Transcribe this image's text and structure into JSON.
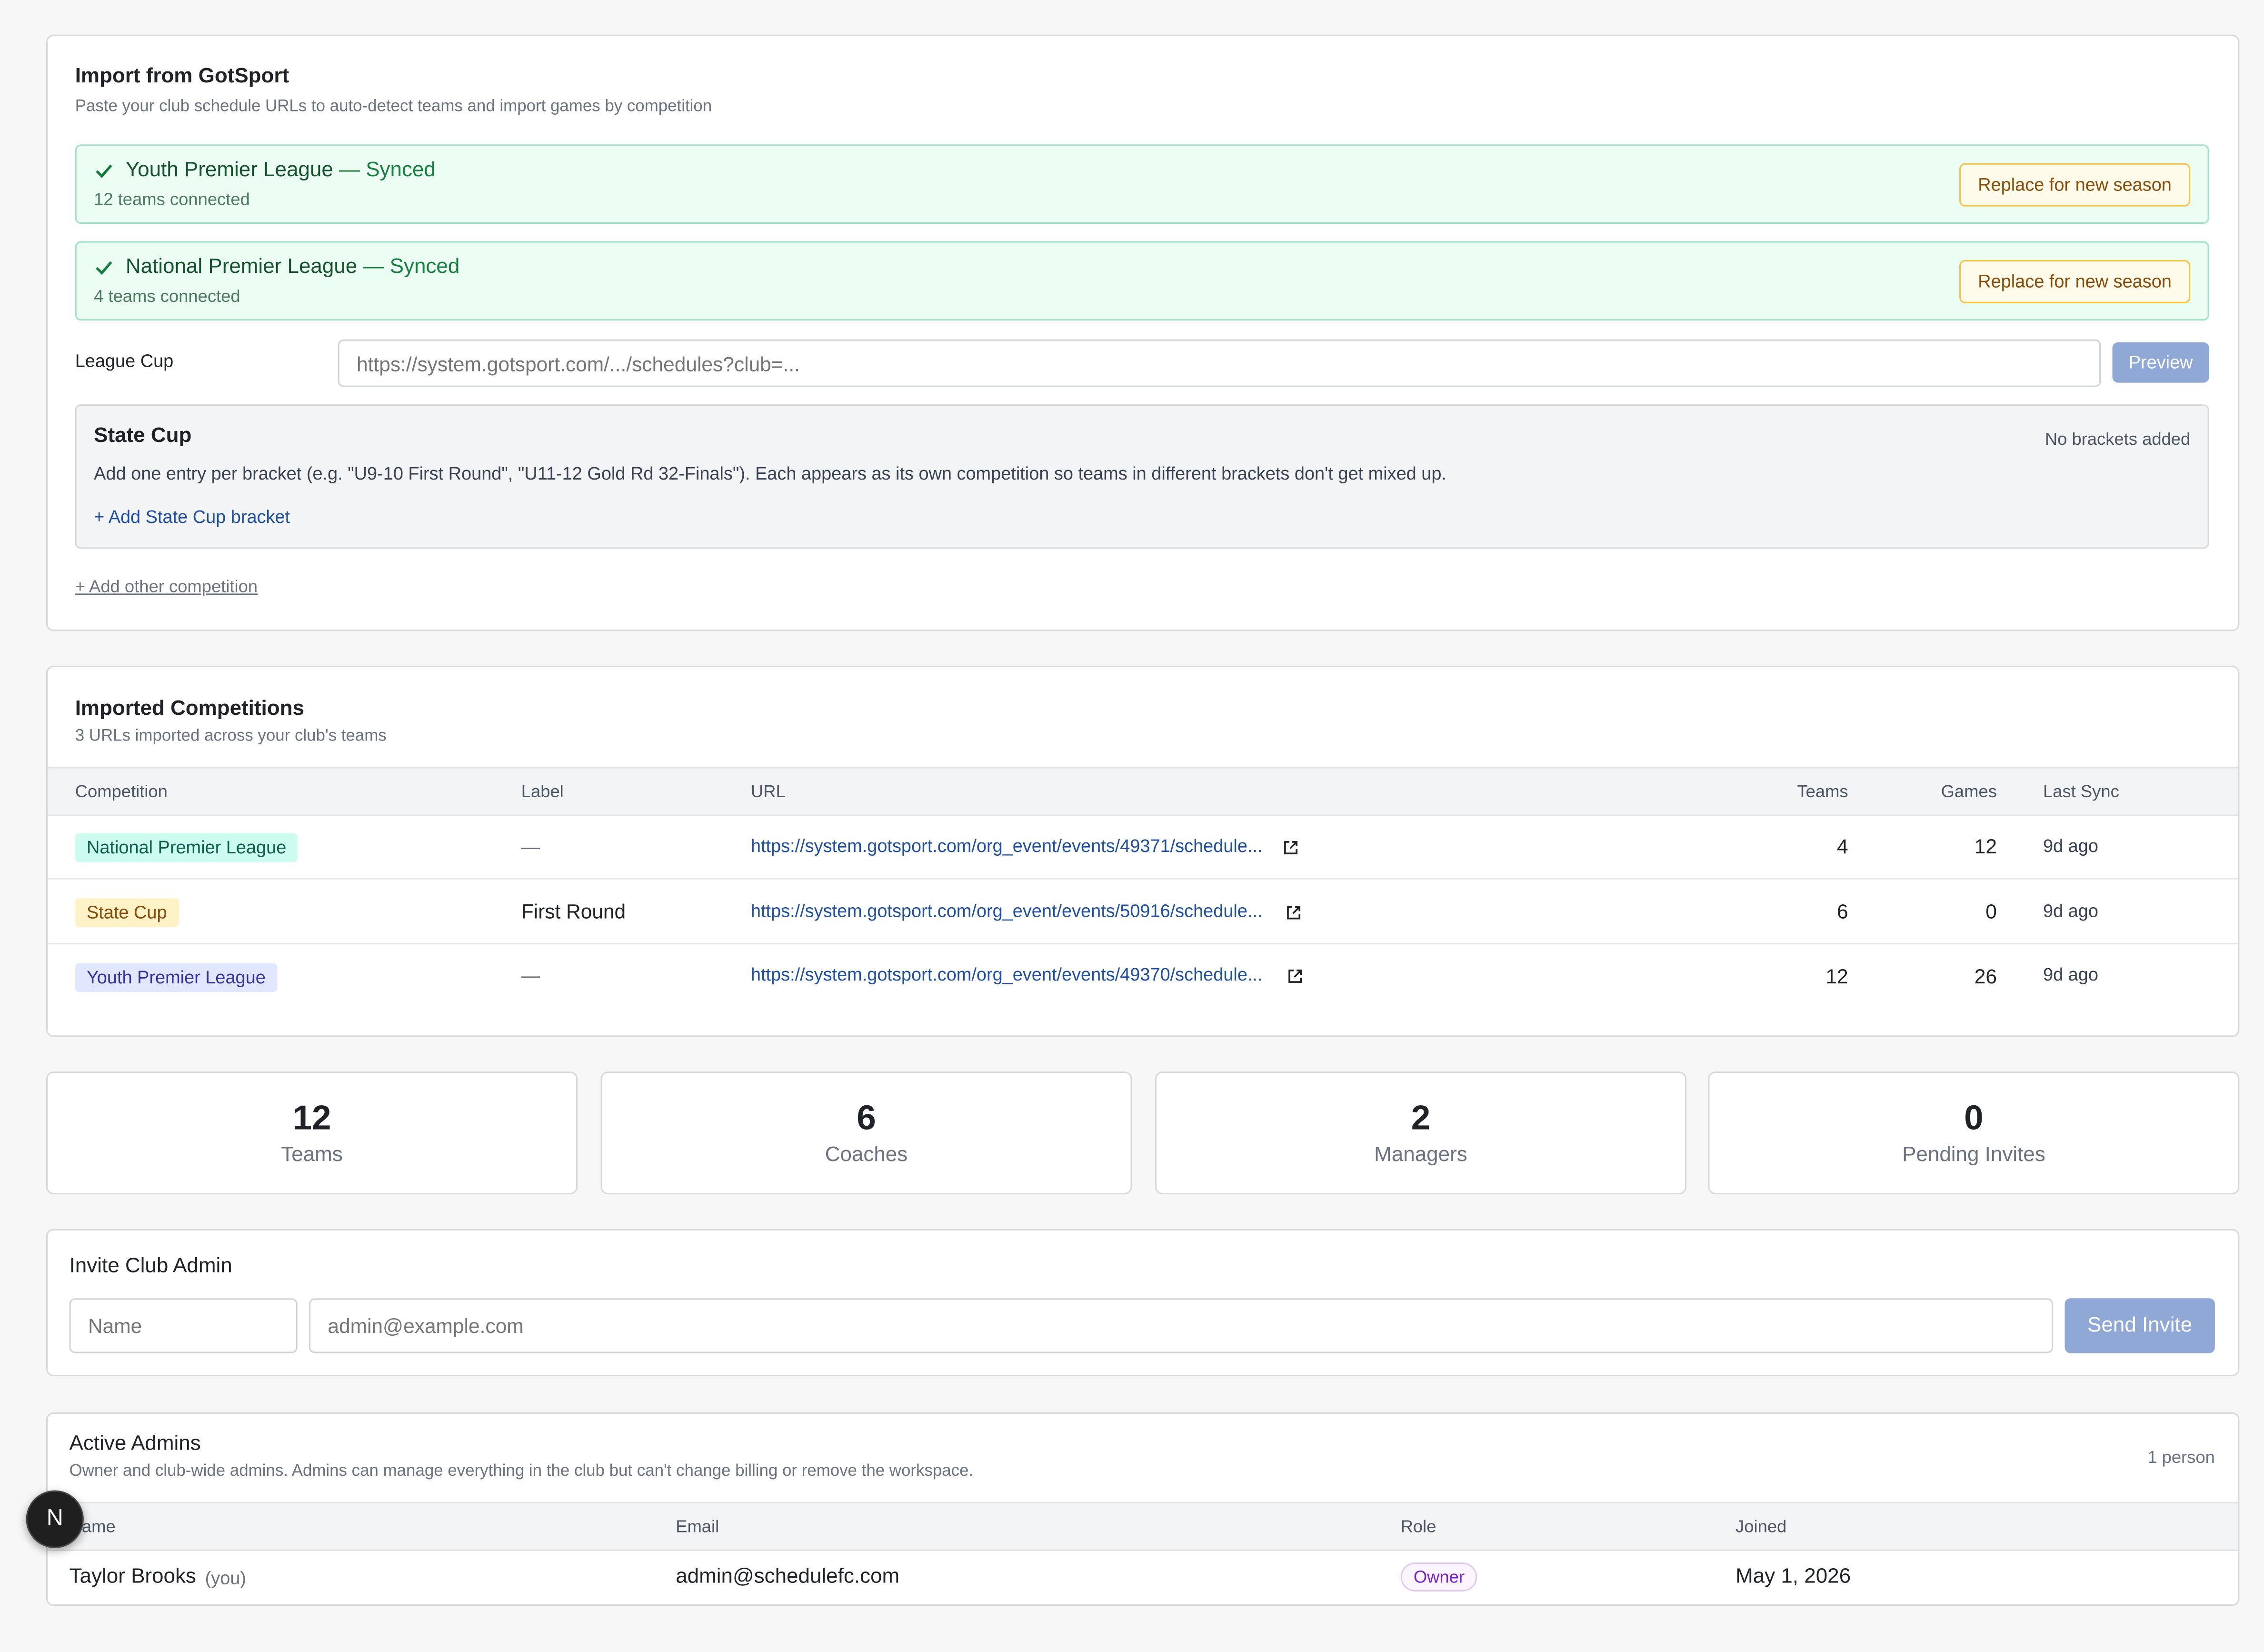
{
  "import": {
    "title": "Import from GotSport",
    "subtitle": "Paste your club schedule URLs to auto-detect teams and import games by competition",
    "synced": [
      {
        "name": "Youth Premier League",
        "status": " — Synced",
        "count": "12 teams connected",
        "button": "Replace for new season"
      },
      {
        "name": "National Premier League",
        "status": " — Synced",
        "count": "4 teams connected",
        "button": "Replace for new season"
      }
    ],
    "league_cup": {
      "label": "League Cup",
      "placeholder": "https://system.gotsport.com/.../schedules?club=...",
      "button": "Preview"
    },
    "state_cup": {
      "title": "State Cup",
      "status": "No brackets added",
      "description": "Add one entry per bracket (e.g. \"U9-10 First Round\", \"U11-12 Gold Rd 32-Finals\"). Each appears as its own competition so teams in different brackets don't get mixed up.",
      "add_link": "+ Add State Cup bracket"
    },
    "add_other": "+ Add other competition"
  },
  "imported": {
    "title": "Imported Competitions",
    "subtitle": "3 URLs imported across your club's teams",
    "columns": [
      "Competition",
      "Label",
      "URL",
      "Teams",
      "Games",
      "Last Sync"
    ],
    "rows": [
      {
        "competition": "National Premier League",
        "label": "—",
        "url": "https://system.gotsport.com/org_event/events/49371/schedule...",
        "teams": "4",
        "games": "12",
        "last_sync": "9d ago"
      },
      {
        "competition": "State Cup",
        "label": "First Round",
        "url": "https://system.gotsport.com/org_event/events/50916/schedule...",
        "teams": "6",
        "games": "0",
        "last_sync": "9d ago"
      },
      {
        "competition": "Youth Premier League",
        "label": "—",
        "url": "https://system.gotsport.com/org_event/events/49370/schedule...",
        "teams": "12",
        "games": "26",
        "last_sync": "9d ago"
      }
    ]
  },
  "stats": [
    {
      "value": "12",
      "label": "Teams"
    },
    {
      "value": "6",
      "label": "Coaches"
    },
    {
      "value": "2",
      "label": "Managers"
    },
    {
      "value": "0",
      "label": "Pending Invites"
    }
  ],
  "invite": {
    "title": "Invite Club Admin",
    "name_placeholder": "Name",
    "email_placeholder": "admin@example.com",
    "button": "Send Invite"
  },
  "admins": {
    "title": "Active Admins",
    "subtitle": "Owner and club-wide admins. Admins can manage everything in the club but can't change billing or remove the workspace.",
    "count": "1 person",
    "columns": [
      "Name",
      "Email",
      "Role",
      "Joined"
    ],
    "rows": [
      {
        "name": "Taylor Brooks",
        "you": "(you)",
        "email": "admin@schedulefc.com",
        "role": "Owner",
        "joined": "May 1, 2026"
      }
    ]
  },
  "dev_badge": "N",
  "colors": {
    "accent_blue": "#8fa8d6",
    "link": "#1e4fa3",
    "synced_bg": "#ecfdf3",
    "replace_border": "#f5c242"
  }
}
